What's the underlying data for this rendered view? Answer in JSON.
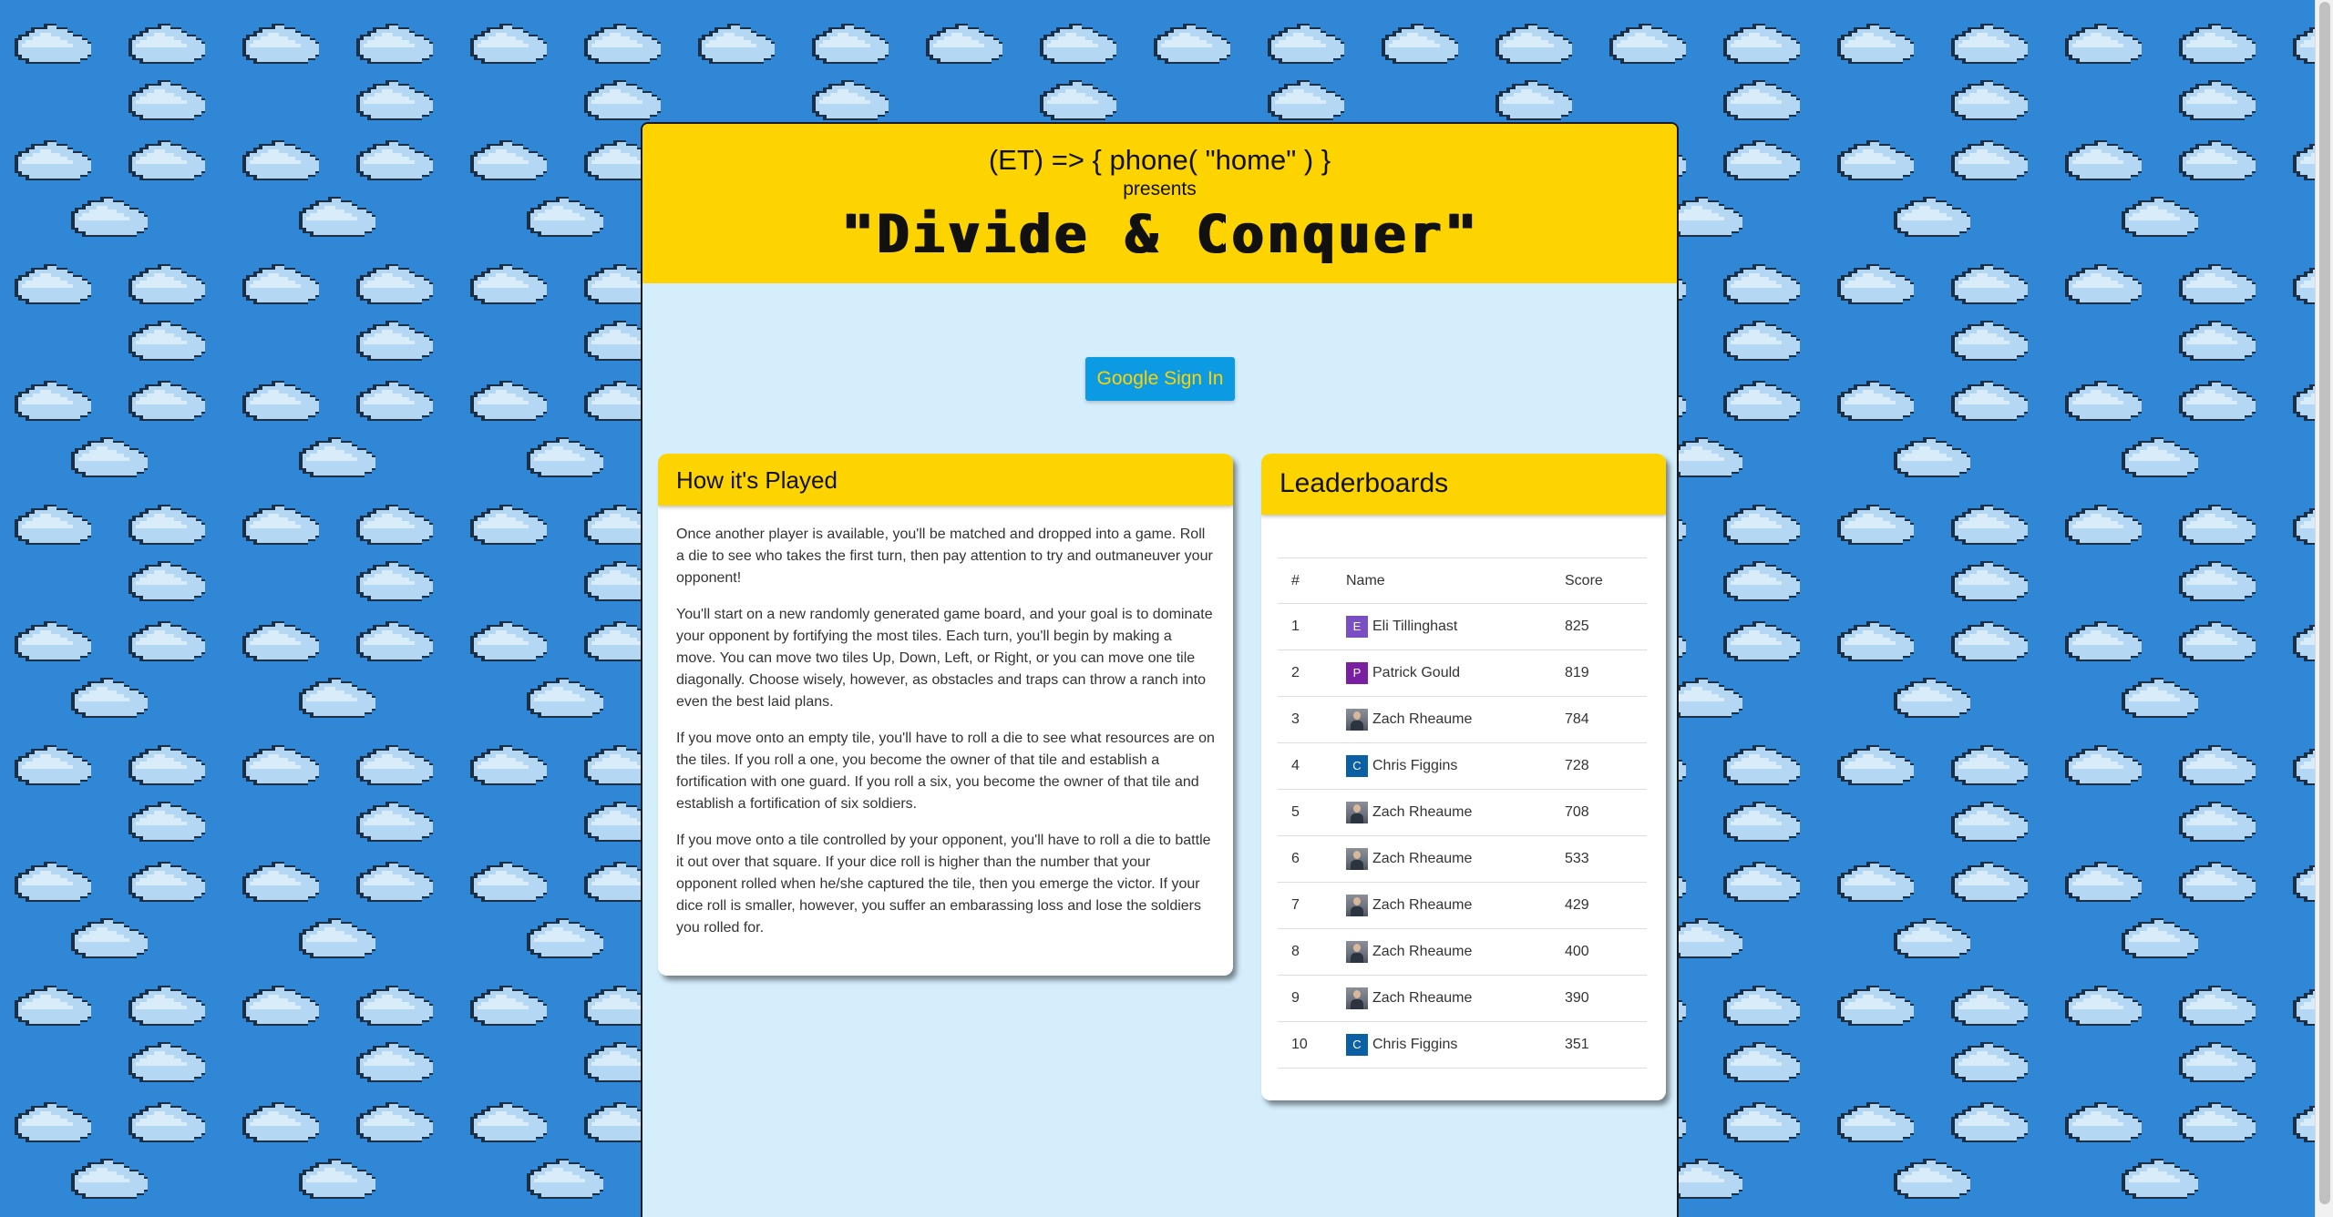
{
  "header": {
    "credit": "(ET) => { phone( \"home\" ) }",
    "presents": "presents",
    "title": "\"Divide & Conquer\""
  },
  "auth": {
    "signin_label": "Google Sign In"
  },
  "how_to_play": {
    "title": "How it's Played",
    "paragraphs": [
      "Once another player is available, you'll be matched and dropped into a game. Roll a die to see who takes the first turn, then pay attention to try and outmaneuver your opponent!",
      "You'll start on a new randomly generated game board, and your goal is to dominate your opponent by fortifying the most tiles. Each turn, you'll begin by making a move. You can move two tiles Up, Down, Left, or Right, or you can move one tile diagonally. Choose wisely, however, as obstacles and traps can throw a ranch into even the best laid plans.",
      "If you move onto an empty tile, you'll have to roll a die to see what resources are on the tiles. If you roll a one, you become the owner of that tile and establish a fortification with one guard. If you roll a six, you become the owner of that tile and establish a fortification of six soldiers.",
      "If you move onto a tile controlled by your opponent, you'll have to roll a die to battle it out over that square. If your dice roll is higher than the number that your opponent rolled when he/she captured the tile, then you emerge the victor. If your dice roll is smaller, however, you suffer an embarassing loss and lose the soldiers you rolled for."
    ]
  },
  "leaderboard": {
    "title": "Leaderboards",
    "columns": {
      "rank": "#",
      "name": "Name",
      "score": "Score"
    },
    "rows": [
      {
        "rank": "1",
        "name": "Eli Tillinghast",
        "score": "825",
        "avatar": "letter",
        "letter": "E",
        "color": "#7b4fc4"
      },
      {
        "rank": "2",
        "name": "Patrick Gould",
        "score": "819",
        "avatar": "letter",
        "letter": "P",
        "color": "#7a1fa2"
      },
      {
        "rank": "3",
        "name": "Zach Rheaume",
        "score": "784",
        "avatar": "photo"
      },
      {
        "rank": "4",
        "name": "Chris Figgins",
        "score": "728",
        "avatar": "letter",
        "letter": "C",
        "color": "#0b5fa5"
      },
      {
        "rank": "5",
        "name": "Zach Rheaume",
        "score": "708",
        "avatar": "photo"
      },
      {
        "rank": "6",
        "name": "Zach Rheaume",
        "score": "533",
        "avatar": "photo"
      },
      {
        "rank": "7",
        "name": "Zach Rheaume",
        "score": "429",
        "avatar": "photo"
      },
      {
        "rank": "8",
        "name": "Zach Rheaume",
        "score": "400",
        "avatar": "photo"
      },
      {
        "rank": "9",
        "name": "Zach Rheaume",
        "score": "390",
        "avatar": "photo"
      },
      {
        "rank": "10",
        "name": "Chris Figgins",
        "score": "351",
        "avatar": "letter",
        "letter": "C",
        "color": "#0b5fa5"
      }
    ]
  },
  "colors": {
    "sky": "#2f87d6",
    "cloud": "#b4d8f4",
    "cloud_outline": "#1b2f47",
    "banner": "#fdd400",
    "panel": "#d5eefc",
    "button": "#0c9ae2"
  },
  "icons": {
    "background_pattern": "pixel-cloud-icon",
    "avatar_photo": "user-photo-icon"
  }
}
